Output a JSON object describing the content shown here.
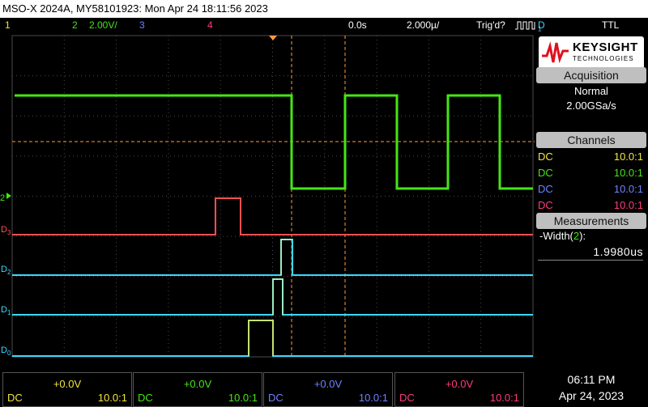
{
  "title": "MSO-X 2024A, MY58101923: Mon Apr 24 18:11:56 2023",
  "status": {
    "ch1_num": "1",
    "ch2_num": "2",
    "ch2_scale": "2.00V/",
    "ch3_num": "3",
    "ch4_num": "4",
    "time_delay": "0.0s",
    "time_scale": "2.000µ/",
    "trigger_state": "Trig'd?",
    "trigger_source": "D",
    "trigger_source_sub": "1",
    "trigger_type": "TTL"
  },
  "brand": {
    "name": "KEYSIGHT",
    "sub": "TECHNOLOGIES"
  },
  "acquisition": {
    "header": "Acquisition",
    "mode": "Normal",
    "rate": "2.00GSa/s"
  },
  "channels": {
    "header": "Channels",
    "rows": [
      {
        "coupling": "DC",
        "probe": "10.0:1",
        "color": "#f2e640"
      },
      {
        "coupling": "DC",
        "probe": "10.0:1",
        "color": "#44e614"
      },
      {
        "coupling": "DC",
        "probe": "10.0:1",
        "color": "#6f82ff"
      },
      {
        "coupling": "DC",
        "probe": "10.0:1",
        "color": "#ff3c78"
      }
    ]
  },
  "measurements": {
    "header": "Measurements",
    "label": "-Width(",
    "label_ch": "2",
    "label_end": "):",
    "value": "1.9980us"
  },
  "bottom_channels": [
    {
      "offset": "+0.0V",
      "coupling": "DC",
      "probe": "10.0:1",
      "color": "#f2e640"
    },
    {
      "offset": "+0.0V",
      "coupling": "DC",
      "probe": "10.0:1",
      "color": "#44e614"
    },
    {
      "offset": "+0.0V",
      "coupling": "DC",
      "probe": "10.0:1",
      "color": "#6f82ff"
    },
    {
      "offset": "+0.0V",
      "coupling": "DC",
      "probe": "10.0:1",
      "color": "#ff3c78"
    }
  ],
  "clock": {
    "time": "06:11 PM",
    "date": "Apr 24, 2023"
  },
  "digital_labels": {
    "d3": "D",
    "d3_sub": "3",
    "d2": "D",
    "d2_sub": "2",
    "d1": "D",
    "d1_sub": "1",
    "d0": "D",
    "d0_sub": "0",
    "analog2": "2"
  },
  "colors": {
    "analog2": "#44e614",
    "d3": "#ff5050",
    "digital": "#3cd7ff",
    "d0_pulse": "#f2e640",
    "cursor": "#ff9a3c",
    "grid": "#4a4a4a"
  }
}
